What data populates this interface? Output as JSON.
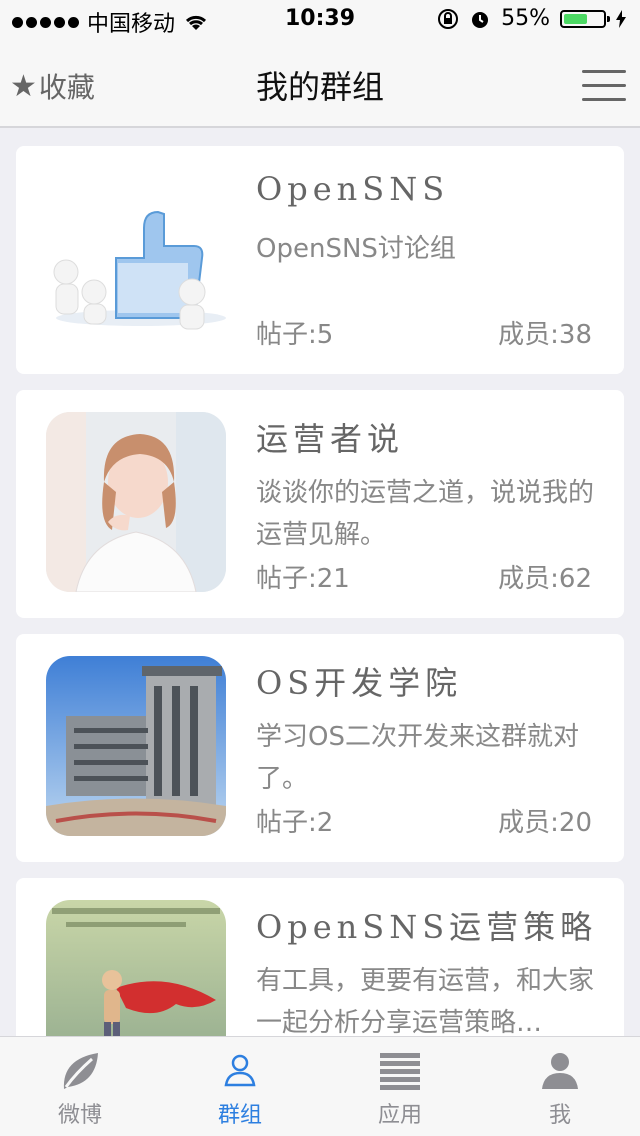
{
  "status_bar": {
    "carrier": "中国移动",
    "time": "10:39",
    "battery": "55%",
    "battery_level": 0.55,
    "icons": [
      "signal-icon",
      "wifi-icon",
      "rotation-lock-icon",
      "alarm-icon",
      "battery-icon",
      "charging-icon"
    ]
  },
  "nav": {
    "favorite_label": "收藏",
    "title": "我的群组",
    "icons": [
      "star-icon",
      "menu-icon"
    ]
  },
  "groups": [
    {
      "name": "OpenSNS",
      "desc": "OpenSNS讨论组",
      "posts": "帖子:5",
      "members": "成员:38"
    },
    {
      "name": "运营者说",
      "desc": "谈谈你的运营之道，说说我的运营见解。",
      "posts": "帖子:21",
      "members": "成员:62"
    },
    {
      "name": "OS开发学院",
      "desc": "学习OS二次开发来这群就对了。",
      "posts": "帖子:2",
      "members": "成员:20"
    },
    {
      "name": "OpenSNS运营策略",
      "desc": "有工具，更要有运营，和大家一起分析分享运营策略…",
      "posts": "",
      "members": ""
    }
  ],
  "tabs": [
    {
      "label": "微博",
      "icon": "leaf-icon"
    },
    {
      "label": "群组",
      "icon": "group-icon",
      "active": true
    },
    {
      "label": "应用",
      "icon": "apps-icon"
    },
    {
      "label": "我",
      "icon": "profile-icon"
    }
  ],
  "colors": {
    "accent": "#2d7fe0",
    "text_secondary": "#888888",
    "background": "#efeff4"
  }
}
